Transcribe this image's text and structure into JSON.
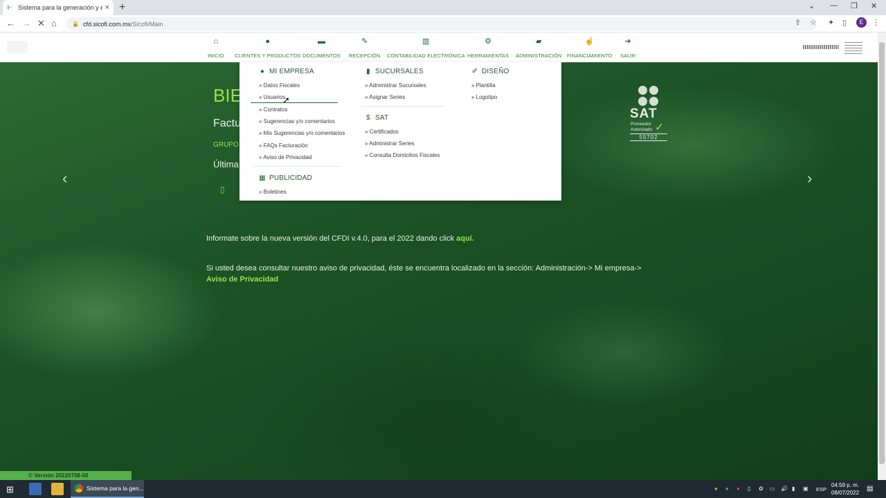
{
  "browser": {
    "tab_title": "Sistema para la generación y en",
    "url_host": "cfd.sicofi.com.mx",
    "url_path": "/Sicofi/Main",
    "profile_initial": "E"
  },
  "nav": {
    "items": [
      {
        "label": "INICIO",
        "icon": "home-icon",
        "glyph": "⌂"
      },
      {
        "label": "CLIENTES Y PRODUCTOS",
        "icon": "user-icon",
        "glyph": "👤"
      },
      {
        "label": "DOCUMENTOS",
        "icon": "folder-icon",
        "glyph": "▬"
      },
      {
        "label": "RECEPCIÓN",
        "icon": "receive-icon",
        "glyph": "✎"
      },
      {
        "label": "CONTABILIDAD ELECTRÓNICA",
        "icon": "bar-chart-icon",
        "glyph": "▥"
      },
      {
        "label": "HERRAMIENTAS",
        "icon": "gears-icon",
        "glyph": "⚙"
      },
      {
        "label": "ADMINISTRACIÓN",
        "icon": "folder-open-icon",
        "glyph": "▰"
      },
      {
        "label": "FINANCIAMIENTO",
        "icon": "hand-coin-icon",
        "glyph": "☝"
      },
      {
        "label": "SALIR",
        "icon": "sign-out-icon",
        "glyph": "➜"
      }
    ]
  },
  "hero": {
    "title": "BIE",
    "subtitle": "Factu",
    "grupo": "GRUPO N",
    "ultima": "Última",
    "info_text": "Informate sobre la nueva versión del CFDI v.4.0, para el 2022 dando click",
    "info_link": "aquí.",
    "privacy_text": "Si usted desea consultar nuestro aviso de privacidad, éste se encuentra localizado en la sección: Administración-> Mi empresa->",
    "privacy_link": "Aviso de Privacidad"
  },
  "sat": {
    "brand": "SAT",
    "line1": "Proveedor",
    "line2": "Autorizado",
    "number": "55702"
  },
  "menu": {
    "mi_empresa": {
      "title": "MI EMPRESA",
      "items": [
        "» Datos Fiscales",
        "» Usuarios",
        "» Contratos",
        "» Sugerencias y/o comentarios",
        "» Mis Sugerencias y/o comentarios",
        "» FAQs Facturación",
        "» Aviso de Privacidad"
      ]
    },
    "publicidad": {
      "title": "PUBLICIDAD",
      "items": [
        "» Boletines"
      ]
    },
    "sucursales": {
      "title": "SUCURSALES",
      "items": [
        "» Administrar Sucursales",
        "» Asignar Series"
      ]
    },
    "sat": {
      "title": "SAT",
      "items": [
        "» Certificados",
        "» Administrar Series",
        "» Consulta Domicilios Fiscales"
      ]
    },
    "diseno": {
      "title": "DISEÑO",
      "items": [
        "» Plantilla",
        "» Logotipo"
      ]
    }
  },
  "footer": {
    "version": "© Versión 20220708-00"
  },
  "taskbar": {
    "chrome_label": "Sistema para la gen...",
    "lang": "ESP",
    "time": "04:59 p. m.",
    "date": "08/07/2022"
  },
  "colors": {
    "accent_green": "#9be04a",
    "brand_green": "#1b6b2a",
    "page_bg": "#1d4f25"
  }
}
